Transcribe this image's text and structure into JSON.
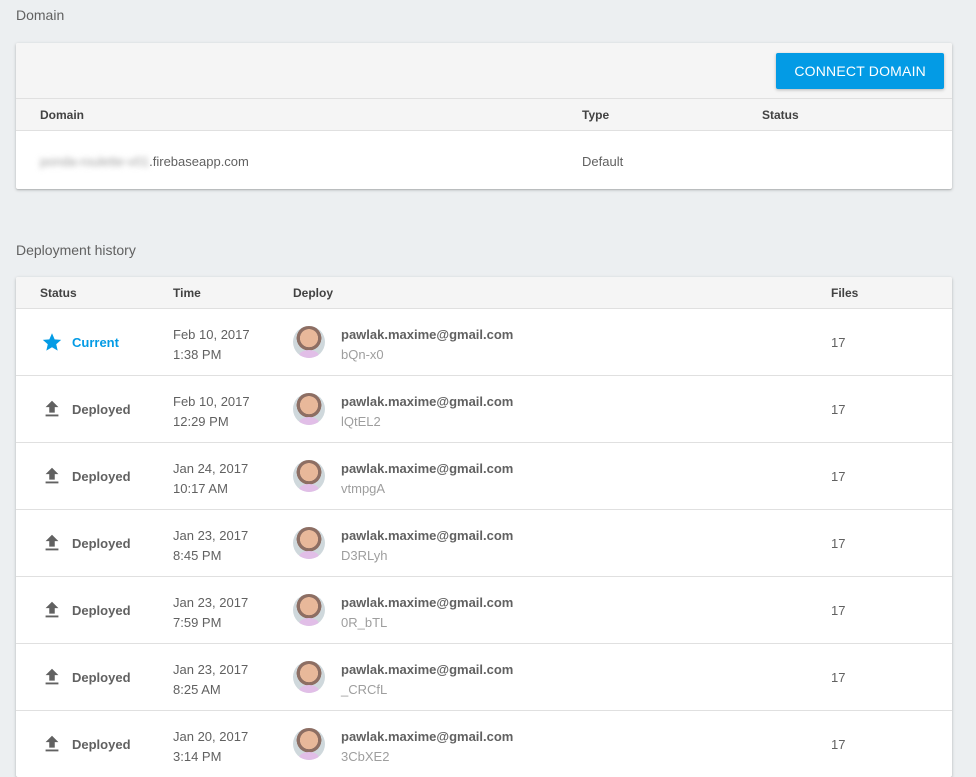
{
  "domain_section": {
    "title": "Domain",
    "connect_button": "CONNECT DOMAIN",
    "columns": {
      "domain": "Domain",
      "type": "Type",
      "status": "Status"
    },
    "rows": [
      {
        "domain_hidden": "ponda-roulette-v01",
        "domain_suffix": ".firebaseapp.com",
        "type": "Default",
        "status": ""
      }
    ]
  },
  "deploy_section": {
    "title": "Deployment history",
    "columns": {
      "status": "Status",
      "time": "Time",
      "deploy": "Deploy",
      "files": "Files"
    },
    "rows": [
      {
        "status": "Current",
        "icon": "star-icon",
        "date": "Feb 10, 2017",
        "clock": "1:38 PM",
        "email": "pawlak.maxime@gmail.com",
        "hash": "bQn-x0",
        "files": "17"
      },
      {
        "status": "Deployed",
        "icon": "upload-icon",
        "date": "Feb 10, 2017",
        "clock": "12:29 PM",
        "email": "pawlak.maxime@gmail.com",
        "hash": "lQtEL2",
        "files": "17"
      },
      {
        "status": "Deployed",
        "icon": "upload-icon",
        "date": "Jan 24, 2017",
        "clock": "10:17 AM",
        "email": "pawlak.maxime@gmail.com",
        "hash": "vtmpgA",
        "files": "17"
      },
      {
        "status": "Deployed",
        "icon": "upload-icon",
        "date": "Jan 23, 2017",
        "clock": "8:45 PM",
        "email": "pawlak.maxime@gmail.com",
        "hash": "D3RLyh",
        "files": "17"
      },
      {
        "status": "Deployed",
        "icon": "upload-icon",
        "date": "Jan 23, 2017",
        "clock": "7:59 PM",
        "email": "pawlak.maxime@gmail.com",
        "hash": "0R_bTL",
        "files": "17"
      },
      {
        "status": "Deployed",
        "icon": "upload-icon",
        "date": "Jan 23, 2017",
        "clock": "8:25 AM",
        "email": "pawlak.maxime@gmail.com",
        "hash": "_CRCfL",
        "files": "17"
      },
      {
        "status": "Deployed",
        "icon": "upload-icon",
        "date": "Jan 20, 2017",
        "clock": "3:14 PM",
        "email": "pawlak.maxime@gmail.com",
        "hash": "3CbXE2",
        "files": "17"
      }
    ]
  },
  "colors": {
    "accent": "#039be5",
    "background": "#eceff1",
    "icon_gray": "#616161"
  }
}
